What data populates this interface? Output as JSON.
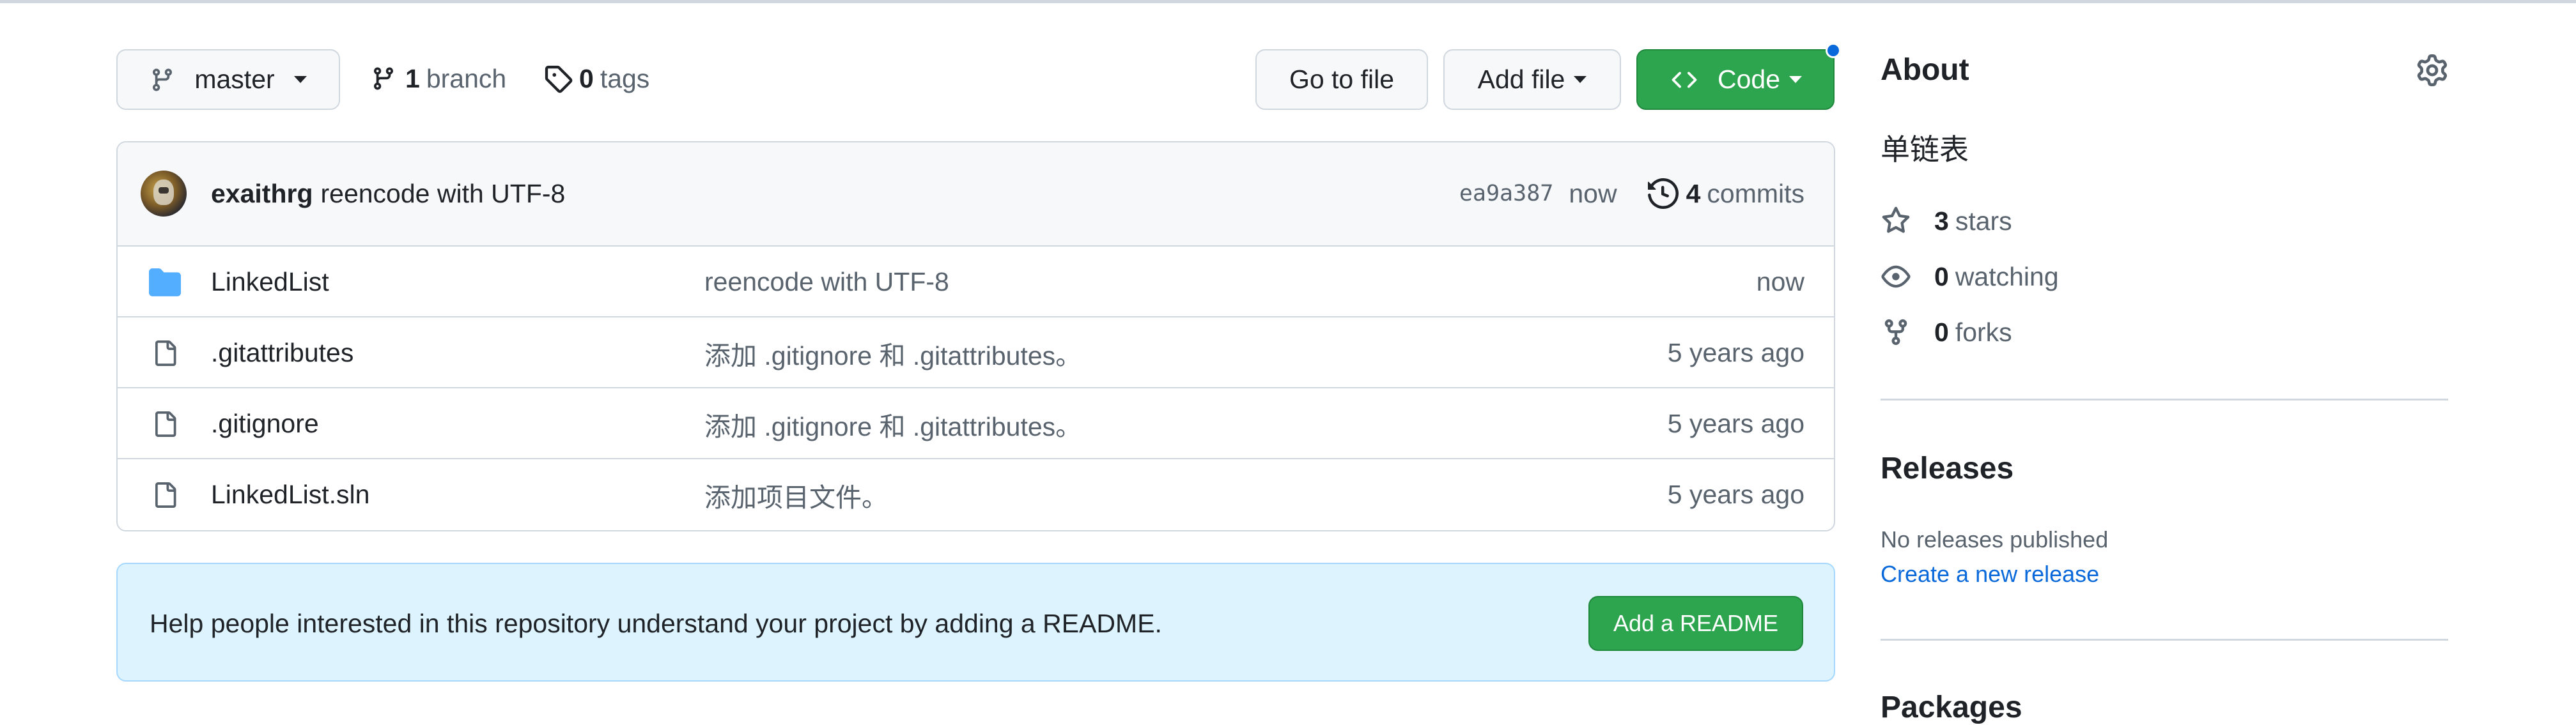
{
  "branch": {
    "current": "master",
    "branch_count": "1",
    "branch_label": "branch",
    "tag_count": "0",
    "tag_label": "tags"
  },
  "actions": {
    "go_to_file": "Go to file",
    "add_file": "Add file",
    "code": "Code"
  },
  "commit": {
    "author": "exaithrg",
    "message": "reencode with UTF-8",
    "hash": "ea9a387",
    "time": "now",
    "commits_count": "4",
    "commits_label": "commits"
  },
  "files": [
    {
      "type": "folder",
      "name": "LinkedList",
      "message": "reencode with UTF-8",
      "age": "now"
    },
    {
      "type": "file",
      "name": ".gitattributes",
      "message": "添加 .gitignore 和 .gitattributes。",
      "age": "5 years ago"
    },
    {
      "type": "file",
      "name": ".gitignore",
      "message": "添加 .gitignore 和 .gitattributes。",
      "age": "5 years ago"
    },
    {
      "type": "file",
      "name": "LinkedList.sln",
      "message": "添加项目文件。",
      "age": "5 years ago"
    }
  ],
  "readme": {
    "text": "Help people interested in this repository understand your project by adding a README.",
    "button": "Add a README"
  },
  "about": {
    "title": "About",
    "description": "单链表",
    "stars_count": "3",
    "stars_label": "stars",
    "watching_count": "0",
    "watching_label": "watching",
    "forks_count": "0",
    "forks_label": "forks"
  },
  "releases": {
    "title": "Releases",
    "none_text": "No releases published",
    "create_link": "Create a new release"
  },
  "packages": {
    "title": "Packages"
  },
  "colors": {
    "primary_green": "#2da44e",
    "link_blue": "#0969da",
    "folder_blue": "#54aeff",
    "border": "#d0d7de"
  }
}
